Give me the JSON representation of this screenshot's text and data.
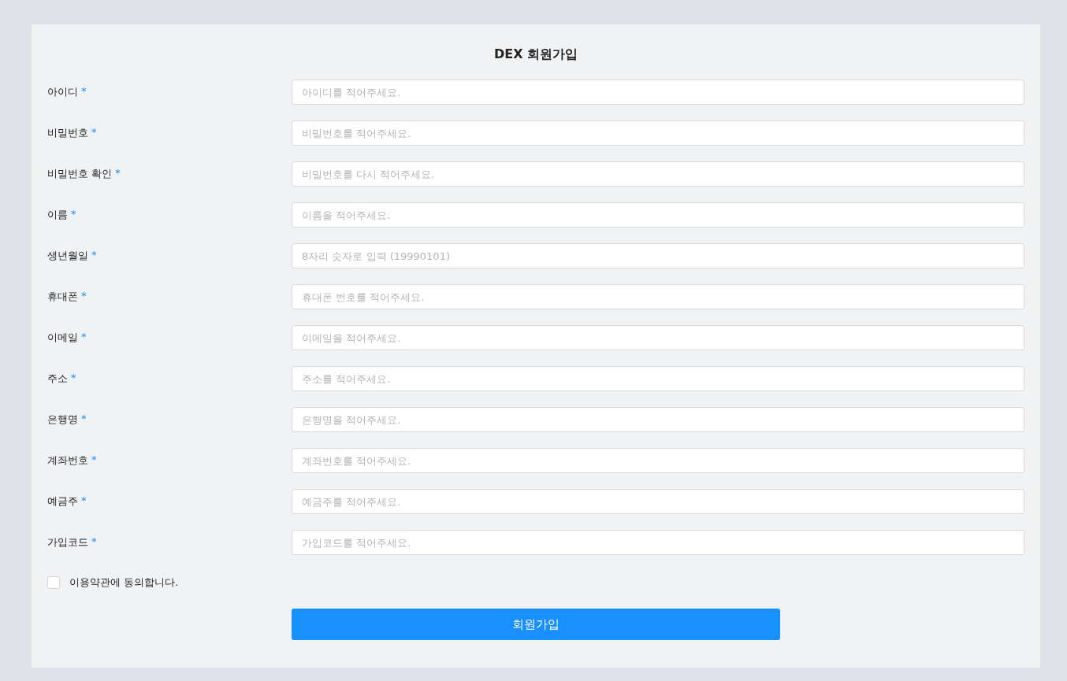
{
  "title": "DEX 회원가입",
  "fields": [
    {
      "label": "아이디",
      "required_mark": "*",
      "placeholder": "아이디를 적어주세요."
    },
    {
      "label": "비밀번호",
      "required_mark": "*",
      "placeholder": "비밀번호를 적어주세요."
    },
    {
      "label": "비밀번호 확인",
      "required_mark": "*",
      "placeholder": "비밀번호를 다시 적어주세요."
    },
    {
      "label": "이름",
      "required_mark": "*",
      "placeholder": "이름을 적어주세요."
    },
    {
      "label": "생년월일",
      "required_mark": "*",
      "placeholder": "8자리 숫자로 입력 (19990101)"
    },
    {
      "label": "휴대폰",
      "required_mark": "*",
      "placeholder": "휴대폰 번호를 적어주세요."
    },
    {
      "label": "이메일",
      "required_mark": "*",
      "placeholder": "이메일을 적어주세요."
    },
    {
      "label": "주소",
      "required_mark": "*",
      "placeholder": "주소를 적어주세요."
    },
    {
      "label": "은행명",
      "required_mark": "*",
      "placeholder": "은행명을 적어주세요."
    },
    {
      "label": "계좌번호",
      "required_mark": "*",
      "placeholder": "계좌번호를 적어주세요."
    },
    {
      "label": "예금주",
      "required_mark": "*",
      "placeholder": "예금주를 적어주세요."
    },
    {
      "label": "가입코드",
      "required_mark": "*",
      "placeholder": "가입코드를 적어주세요."
    }
  ],
  "agreement": {
    "label": "이용약관에 동의합니다.",
    "checked": false
  },
  "submit": "회원가입"
}
